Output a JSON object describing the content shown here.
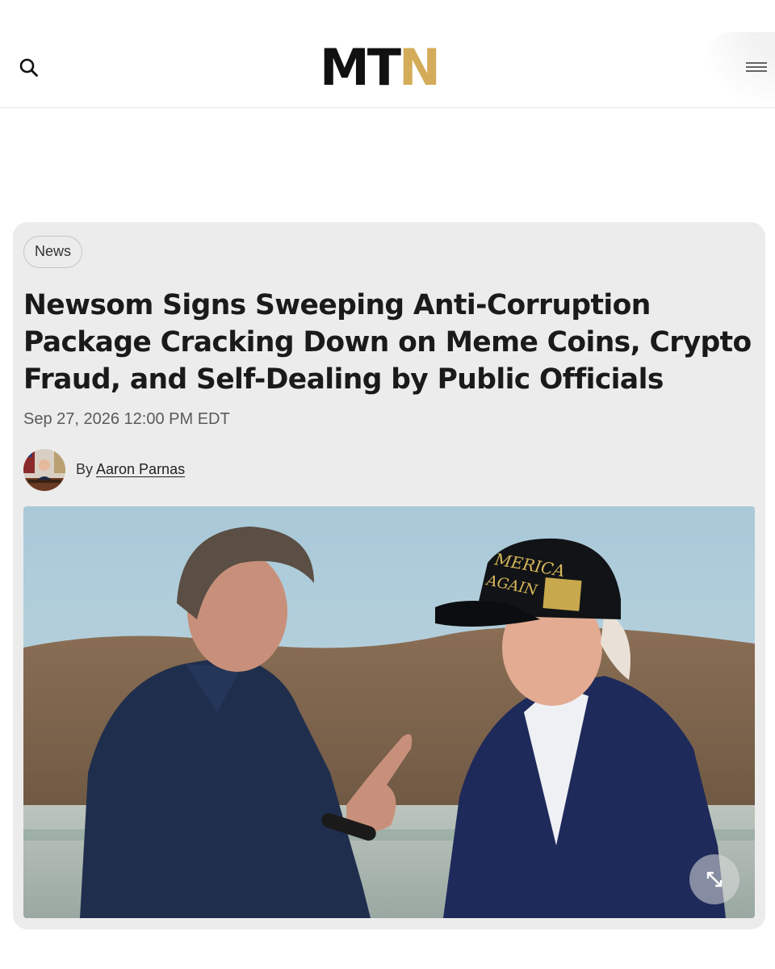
{
  "header": {
    "logo_main": "MT",
    "logo_accent": "N",
    "search_icon": "search-icon",
    "menu_icon": "hamburger-menu-icon"
  },
  "article": {
    "category": "News",
    "headline": "Newsom Signs Sweeping Anti-Corruption Package Cracking Down on Meme Coins, Crypto Fraud, and Self-Dealing by Public Officials",
    "date": "Sep 27, 2026 12:00 PM EDT",
    "byline_prefix": "By ",
    "author": "Aaron Parnas",
    "expand_icon": "expand-icon"
  },
  "colors": {
    "logo_dark": "#111111",
    "logo_accent": "#d4ac59",
    "card_background": "#ececec",
    "headline": "#1a1a1a"
  }
}
